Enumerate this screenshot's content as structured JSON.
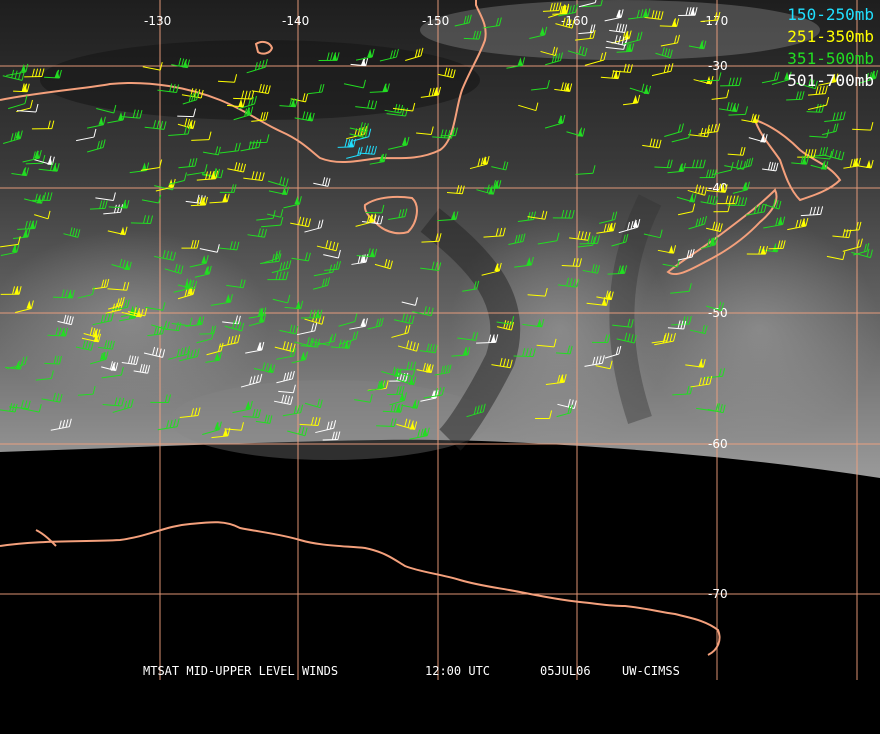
{
  "map": {
    "longitude_labels": [
      "-130",
      "-140",
      "-150",
      "-160",
      "-170"
    ],
    "latitude_labels": [
      "-30",
      "-40",
      "-50",
      "-60",
      "-70"
    ],
    "grid_color": "#f3a27f",
    "coast_color": "#f4a07c",
    "background": "#000000"
  },
  "legend": [
    {
      "label": "150-250mb",
      "color": "#20e0ff"
    },
    {
      "label": "251-350mb",
      "color": "#ffff00"
    },
    {
      "label": "351-500mb",
      "color": "#22dd22"
    },
    {
      "label": "501-700mb",
      "color": "#ffffff"
    }
  ],
  "caption": {
    "title": "MTSAT MID-UPPER LEVEL WINDS",
    "time": "12:00 UTC",
    "date": "05JUL06",
    "source": "UW-CIMSS"
  }
}
